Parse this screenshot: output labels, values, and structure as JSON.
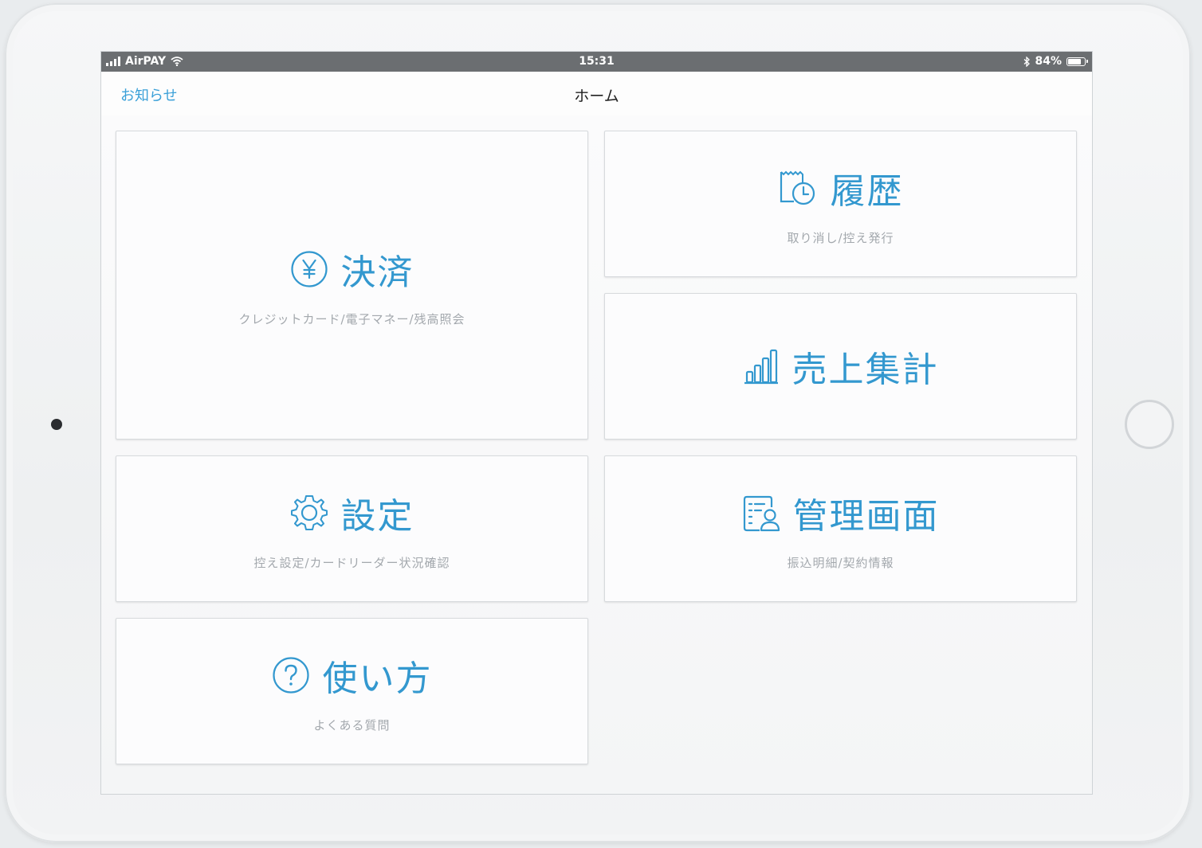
{
  "statusbar": {
    "carrier": "AirPAY",
    "time": "15:31",
    "battery": "84%",
    "battery_level": 0.84
  },
  "navbar": {
    "left_link": "お知らせ",
    "title": "ホーム"
  },
  "tiles": [
    {
      "label": "決済",
      "sub": "クレジットカード/電子マネー/残高照会",
      "icon": "yen-circle-icon"
    },
    {
      "label": "履歴",
      "sub": "取り消し/控え発行",
      "icon": "receipt-clock-icon"
    },
    {
      "label": "売上集計",
      "sub": "",
      "icon": "bar-chart-icon"
    },
    {
      "label": "設定",
      "sub": "控え設定/カードリーダー状況確認",
      "icon": "gear-icon"
    },
    {
      "label": "管理画面",
      "sub": "振込明細/契約情報",
      "icon": "document-person-icon"
    },
    {
      "label": "使い方",
      "sub": "よくある質問",
      "icon": "question-circle-icon"
    }
  ],
  "colors": {
    "accent": "#3398cf",
    "link": "#3aa0d8",
    "subtext": "#a3a8ad",
    "statusbar": "#6b6e71"
  }
}
